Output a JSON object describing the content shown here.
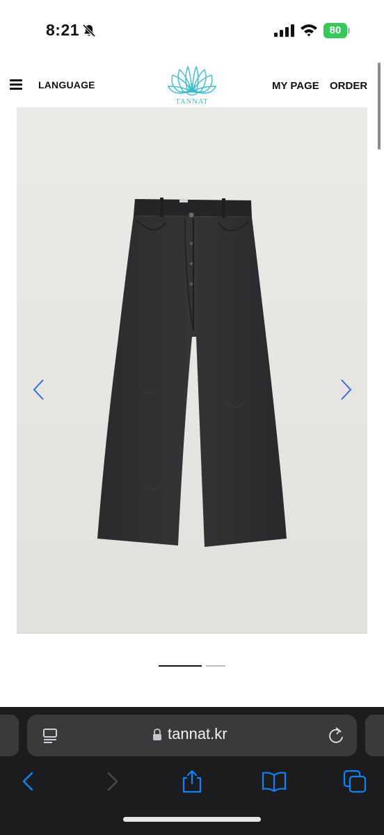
{
  "status_bar": {
    "time": "8:21",
    "battery_percent": "80",
    "colors": {
      "battery": "#38c759"
    }
  },
  "header": {
    "language_label": "LANGUAGE",
    "logo_text": "TANNAT",
    "my_page_label": "MY PAGE",
    "order_label": "ORDER",
    "logo_color": "#3bbdc9"
  },
  "gallery": {
    "current_slide": 1,
    "total_slides": 2,
    "arrow_color": "#2f6fd8"
  },
  "browser": {
    "url": "tannat.kr",
    "accent_color": "#0a84ff"
  },
  "icons": [
    "menu-icon",
    "chevron-left-icon",
    "chevron-right-icon",
    "reader-icon",
    "lock-icon",
    "reload-icon",
    "back-icon",
    "forward-icon",
    "share-icon",
    "bookmarks-icon",
    "tabs-icon",
    "bell-slash-icon",
    "signal-icon",
    "wifi-icon"
  ]
}
